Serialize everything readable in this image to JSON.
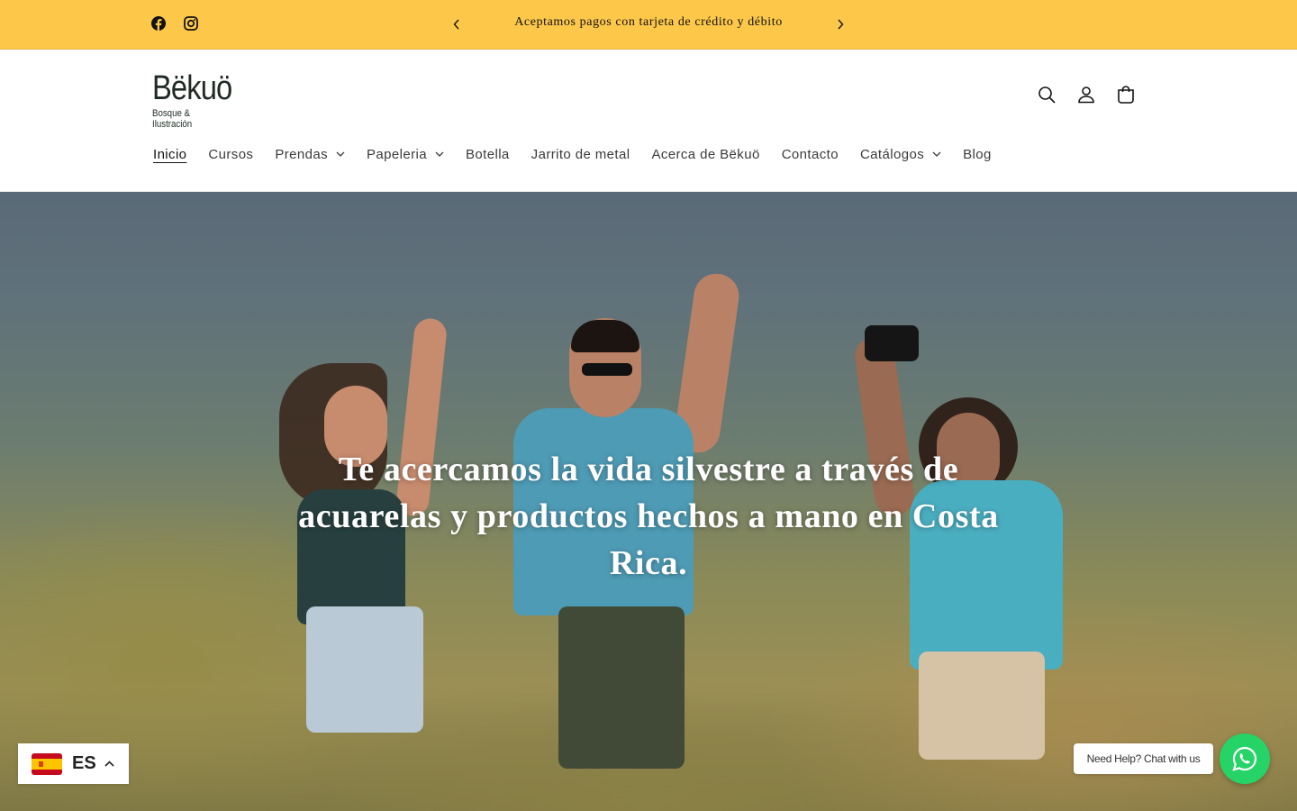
{
  "announcement": {
    "text": "Aceptamos pagos con tarjeta de crédito y débito",
    "background": "#fdc84a"
  },
  "social": {
    "icons": [
      "facebook-icon",
      "instagram-icon"
    ]
  },
  "header": {
    "logo_main": "Bëkuö",
    "logo_sub": "Bosque & Ilustración",
    "icons": [
      "search-icon",
      "account-icon",
      "cart-icon"
    ]
  },
  "nav": {
    "items": [
      {
        "label": "Inicio",
        "active": true,
        "dropdown": false
      },
      {
        "label": "Cursos",
        "active": false,
        "dropdown": false
      },
      {
        "label": "Prendas",
        "active": false,
        "dropdown": true
      },
      {
        "label": "Papeleria",
        "active": false,
        "dropdown": true
      },
      {
        "label": "Botella",
        "active": false,
        "dropdown": false
      },
      {
        "label": "Jarrito de metal",
        "active": false,
        "dropdown": false
      },
      {
        "label": "Acerca de Bëkuö",
        "active": false,
        "dropdown": false
      },
      {
        "label": "Contacto",
        "active": false,
        "dropdown": false
      },
      {
        "label": "Catálogos",
        "active": false,
        "dropdown": true
      },
      {
        "label": "Blog",
        "active": false,
        "dropdown": false
      }
    ]
  },
  "hero": {
    "title": "Te acercamos la vida silvestre a través de acuarelas y productos hechos a mano en Costa Rica."
  },
  "language": {
    "code": "ES",
    "flag": "spain-flag-icon"
  },
  "whatsapp": {
    "label": "Need Help? Chat with us",
    "color": "#25d366"
  }
}
